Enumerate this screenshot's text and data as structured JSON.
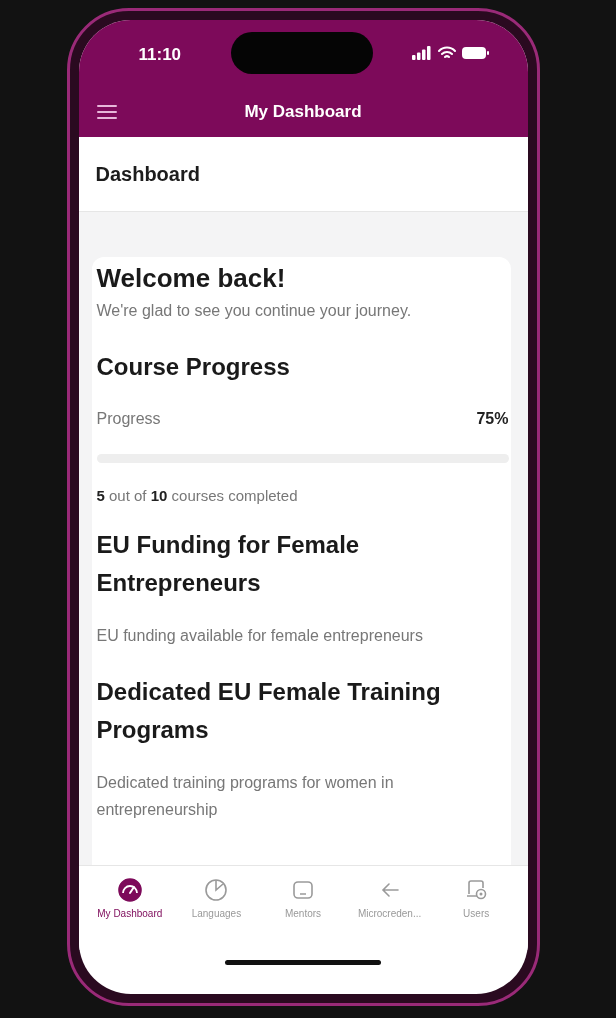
{
  "status_bar": {
    "time": "11:10"
  },
  "header": {
    "title": "My Dashboard"
  },
  "page_title": "Dashboard",
  "welcome": {
    "title": "Welcome back!",
    "subtitle": "We're glad to see you continue your journey."
  },
  "progress": {
    "title": "Course Progress",
    "label": "Progress",
    "value": "75%",
    "level": 0,
    "summary": "**5** out of **10** courses completed"
  },
  "sections": [
    {
      "title": "EU Funding for Female Entrepreneurs",
      "description": "EU funding available for female entrepreneurs"
    },
    {
      "title": "Dedicated EU Female Training Programs",
      "description": "Dedicated training programs for women in entrepreneurship"
    }
  ],
  "tab_bar": [
    {
      "kind": "gauge",
      "label": "My Dashboard",
      "selected": true
    },
    {
      "kind": "pie",
      "label": "Languages",
      "selected": false
    },
    {
      "kind": "screen",
      "label": "Mentors",
      "selected": false
    },
    {
      "kind": "arrow",
      "label": "Microcreden...",
      "selected": false
    },
    {
      "kind": "device",
      "label": "Users",
      "selected": false
    }
  ]
}
